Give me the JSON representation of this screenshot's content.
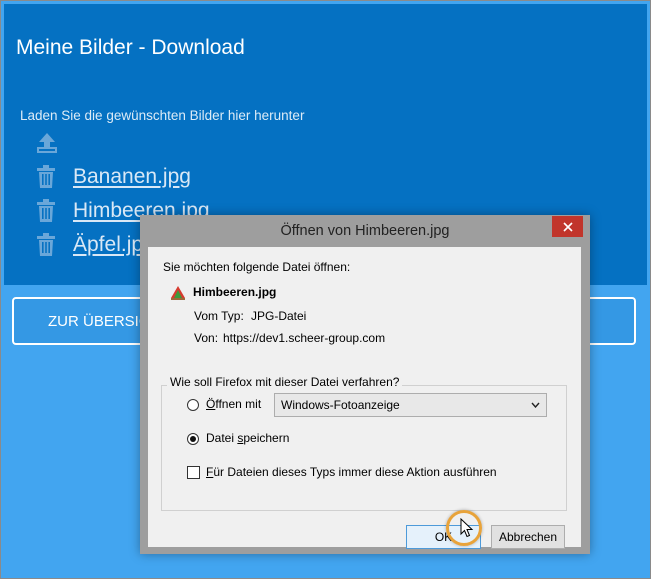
{
  "app": {
    "title": "Meine Bilder - Download",
    "subtitle": "Laden Sie die gewünschten Bilder hier herunter",
    "upload_icon": "upload-icon",
    "files": [
      {
        "name": "Bananen.jpg",
        "icon": "trash-icon"
      },
      {
        "name": "Himbeeren.jpg",
        "icon": "trash-icon"
      },
      {
        "name": "Äpfel.jpg",
        "icon": "trash-icon"
      }
    ],
    "overview_button": "ZUR ÜBERSICHT"
  },
  "dialog": {
    "title": "Öffnen von Himbeeren.jpg",
    "prompt": "Sie möchten folgende Datei öffnen:",
    "filename": "Himbeeren.jpg",
    "type_label": "Vom Typ:",
    "type_value": "JPG-Datei",
    "from_label": "Von:",
    "from_value": "https://dev1.scheer-group.com",
    "group_label": "Wie soll Firefox mit dieser Datei verfahren?",
    "open_with_label": "Öffnen mit",
    "open_with_selected": "Windows-Fotoanzeige",
    "save_label": "Datei speichern",
    "always_label": "Für Dateien dieses Typs immer diese Aktion ausführen",
    "ok_label": "OK",
    "cancel_label": "Abbrechen",
    "selected_action": "save",
    "always_checked": false
  },
  "colors": {
    "page_bg": "#42a5f0",
    "panel_bg": "#0571c2",
    "dialog_frame": "#9e9e9e",
    "close_red": "#c1352b",
    "cursor_ring": "#e8a33a"
  }
}
